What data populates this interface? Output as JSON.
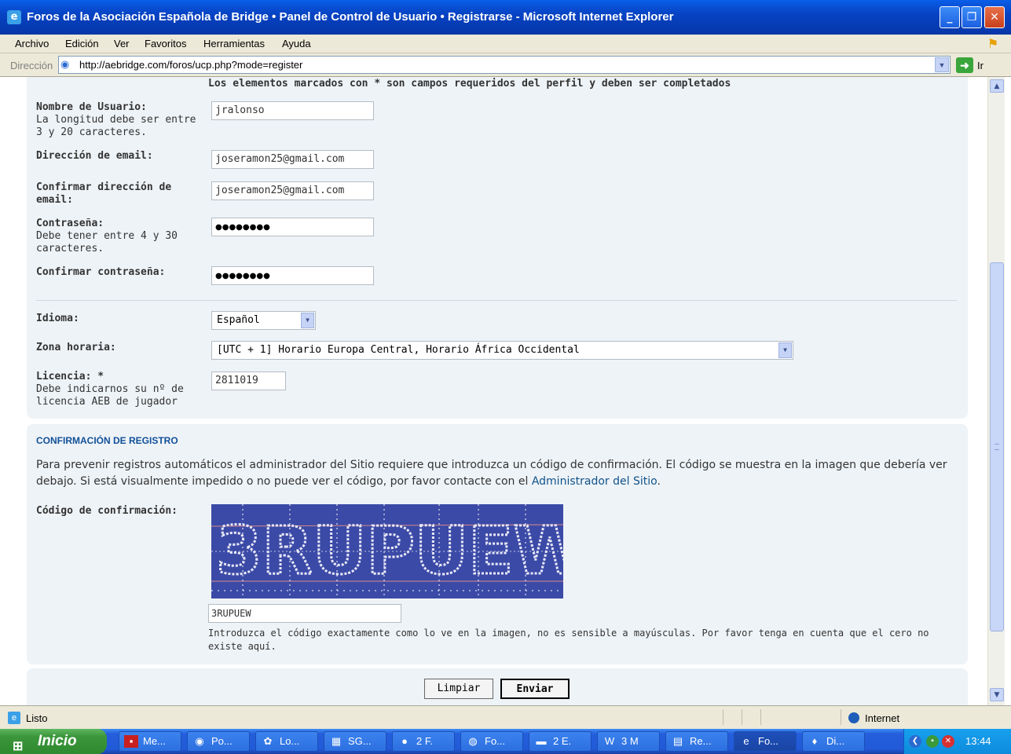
{
  "window": {
    "title": "Foros de la Asociación Española de Bridge • Panel de Control de Usuario • Registrarse - Microsoft Internet Explorer",
    "icon": "ie-icon"
  },
  "menu": [
    "Archivo",
    "Edición",
    "Ver",
    "Favoritos",
    "Herramientas",
    "Ayuda"
  ],
  "address": {
    "label": "Dirección",
    "url": "http://aebridge.com/foros/ucp.php?mode=register",
    "go_label": "Ir"
  },
  "form": {
    "required_note": "Los elementos marcados con * son campos requeridos del perfil y deben ser completados",
    "username": {
      "label": "Nombre de Usuario:",
      "desc": "La longitud debe ser entre 3 y 20 caracteres.",
      "value": "jralonso"
    },
    "email": {
      "label": "Dirección de email:",
      "value": "joseramon25@gmail.com"
    },
    "email_confirm": {
      "label": "Confirmar dirección de email:",
      "value": "joseramon25@gmail.com"
    },
    "password": {
      "label": "Contraseña:",
      "desc": "Debe tener entre 4 y 30 caracteres.",
      "value": "●●●●●●●●"
    },
    "password_confirm": {
      "label": "Confirmar contraseña:",
      "value": "●●●●●●●●"
    },
    "language": {
      "label": "Idioma:",
      "value": "Español"
    },
    "timezone": {
      "label": "Zona horaria:",
      "value": "[UTC + 1] Horario Europa Central, Horario África Occidental"
    },
    "license": {
      "label": "Licencia: *",
      "desc": "Debe indicarnos su nº de licencia AEB de jugador",
      "value": "2811019"
    }
  },
  "confirmation": {
    "title": "CONFIRMACIÓN DE REGISTRO",
    "text": "Para prevenir registros automáticos el administrador del Sitio requiere que introduzca un código de confirmación. El código se muestra en la imagen que debería ver debajo. Si está visualmente impedido o no puede ver el código, por favor contacte con el ",
    "link": "Administrador del Sitio",
    "text_end": ".",
    "code_label": "Código de confirmación:",
    "captcha_text": "3RUPUEW",
    "code_value": "3RUPUEW",
    "hint": "Introduzca el código exactamente como lo ve en la imagen, no es sensible a mayúsculas. Por favor tenga en cuenta que el cero no existe aquí."
  },
  "buttons": {
    "reset": "Limpiar",
    "submit": "Enviar"
  },
  "status": {
    "text": "Listo",
    "zone": "Internet"
  },
  "taskbar": {
    "start": "Inicio",
    "items": [
      "Me...",
      "Po...",
      "Lo...",
      "SG...",
      "2 F.",
      "Fo...",
      "2 E.",
      "3 M",
      "Re...",
      "Fo...",
      "Di..."
    ],
    "clock": "13:44"
  }
}
